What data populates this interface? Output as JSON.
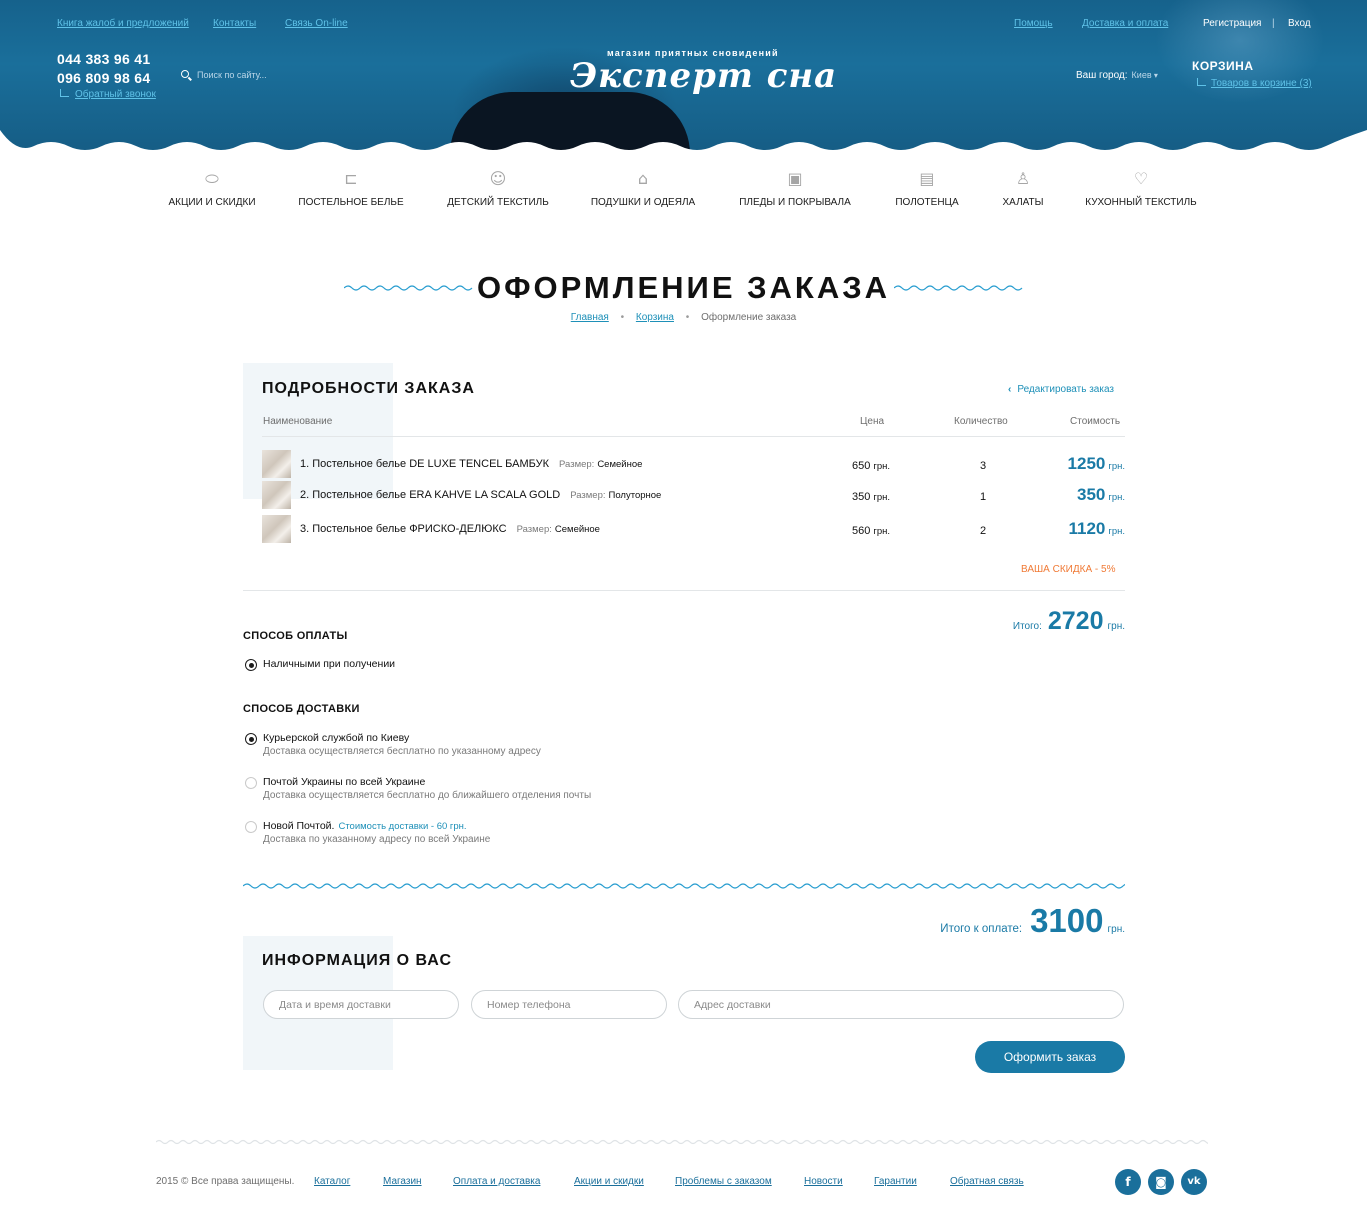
{
  "top_links": {
    "complaints": "Книга жалоб и предложений",
    "contacts": "Контакты",
    "online": "Связь On-line",
    "help": "Помощь",
    "delivery": "Доставка и оплата",
    "register": "Регистрация",
    "separator": "|",
    "login": "Вход"
  },
  "phones": [
    "044 383 96 41",
    "096 809 98 64"
  ],
  "callback": "Обратный звонок",
  "search": {
    "placeholder": "Поиск по сайту..."
  },
  "logo": {
    "tagline": "магазин приятных сновидений",
    "name": "Эксперт сна"
  },
  "city": {
    "label": "Ваш город:",
    "value": "Киев"
  },
  "cart": {
    "title": "КОРЗИНА",
    "items_link": "Товаров в корзине (3)"
  },
  "nav": [
    {
      "label": "АКЦИИ И СКИДКИ",
      "icon": "discount-pillow-icon"
    },
    {
      "label": "ПОСТЕЛЬНОЕ БЕЛЬЕ",
      "icon": "bed-icon"
    },
    {
      "label": "ДЕТСКИЙ ТЕКСТИЛЬ",
      "icon": "baby-icon"
    },
    {
      "label": "ПОДУШКИ И ОДЕЯЛА",
      "icon": "pillow-icon"
    },
    {
      "label": "ПЛЕДЫ И ПОКРЫВАЛА",
      "icon": "blanket-icon"
    },
    {
      "label": "ПОЛОТЕНЦА",
      "icon": "towel-icon"
    },
    {
      "label": "ХАЛАТЫ",
      "icon": "robe-icon"
    },
    {
      "label": "КУХОННЫЙ ТЕКСТИЛЬ",
      "icon": "kitchen-heart-icon"
    }
  ],
  "page": {
    "title": "ОФОРМЛЕНИЕ ЗАКАЗА",
    "breadcrumbs": [
      "Главная",
      "Корзина",
      "Оформление заказа"
    ]
  },
  "order": {
    "title": "ПОДРОБНОСТИ ЗАКАЗА",
    "edit_link": "Редактировать заказ",
    "columns": {
      "name": "Наименование",
      "price": "Цена",
      "qty": "Количество",
      "cost": "Стоимость"
    },
    "size_label": "Размер:",
    "currency": "грн.",
    "items": [
      {
        "name": "1. Постельное белье DE LUXE TENCEL БАМБУК",
        "size": "Семейное",
        "price": "650",
        "qty": "3",
        "cost": "1250"
      },
      {
        "name": "2. Постельное белье ERA KAHVE LA SCALA GOLD",
        "size": "Полуторное",
        "price": "350",
        "qty": "1",
        "cost": "350"
      },
      {
        "name": "3. Постельное белье ФРИСКО-ДЕЛЮКС",
        "size": "Семейное",
        "price": "560",
        "qty": "2",
        "cost": "1120"
      }
    ],
    "discount": "ВАША СКИДКА - 5%",
    "total_label": "Итого:",
    "total_value": "2720"
  },
  "payment": {
    "title": "СПОСОБ ОПЛАТЫ",
    "options": [
      {
        "label": "Наличными при получении",
        "selected": true
      }
    ]
  },
  "delivery": {
    "title": "СПОСОБ ДОСТАВКИ",
    "options": [
      {
        "label": "Курьерской службой по Киеву",
        "extra": "",
        "desc": "Доставка осуществляется бесплатно по указанному адресу",
        "selected": true
      },
      {
        "label": "Почтой Украины по всей Украине",
        "extra": "",
        "desc": "Доставка осуществляется бесплатно до ближайшего отделения почты",
        "selected": false
      },
      {
        "label": "Новой Почтой.",
        "extra": "Стоимость доставки - 60 грн.",
        "desc": "Доставка по указанному адресу по всей Украине",
        "selected": false
      }
    ]
  },
  "payable": {
    "label": "Итого к оплате:",
    "value": "3100",
    "currency": "грн."
  },
  "info": {
    "title": "ИНФОРМАЦИЯ О ВАС",
    "fields": {
      "datetime_placeholder": "Дата и время доставки",
      "phone_placeholder": "Номер телефона",
      "address_placeholder": "Адрес доставки"
    },
    "submit": "Оформить заказ"
  },
  "footer": {
    "copyright": "2015 © Все права защищены.",
    "links": [
      "Каталог",
      "Магазин",
      "Оплата и доставка",
      "Акции и скидки",
      "Проблемы с заказом",
      "Новости",
      "Гарантии",
      "Обратная связь"
    ],
    "social": [
      {
        "icon": "facebook-icon",
        "glyph": "f"
      },
      {
        "icon": "instagram-icon",
        "glyph": "◙"
      },
      {
        "icon": "vk-icon",
        "glyph": "vk"
      }
    ]
  },
  "colors": {
    "brand": "#1a7aa6",
    "link": "#1e90b8",
    "accent_orange": "#f07a36",
    "header_blue": "#1a6f9b"
  }
}
